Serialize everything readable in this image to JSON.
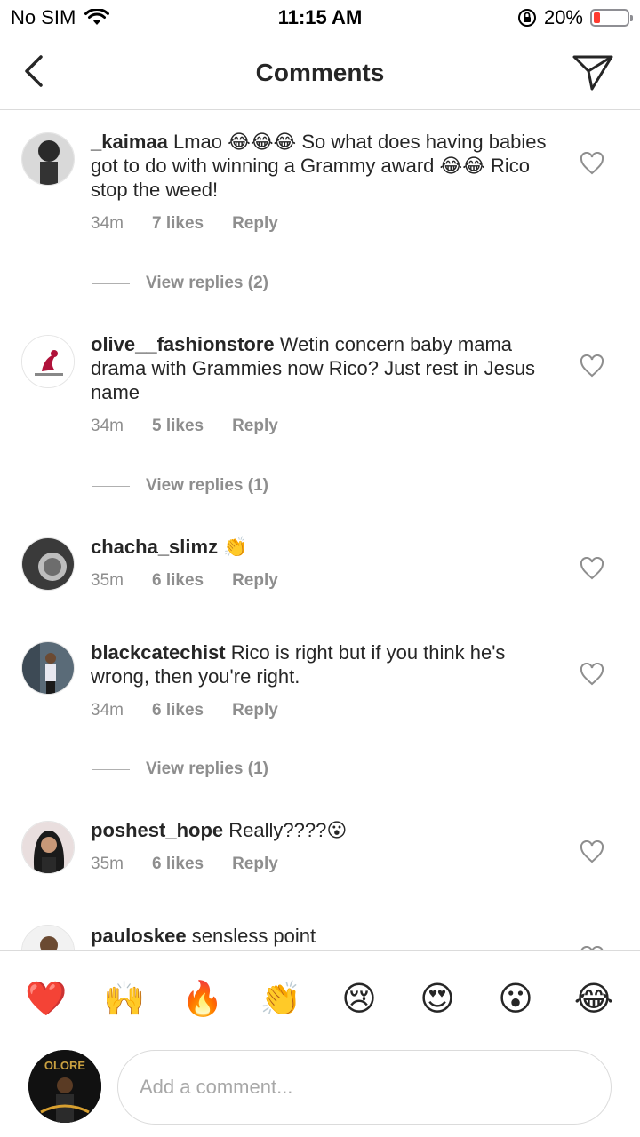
{
  "status_bar": {
    "carrier": "No SIM",
    "time": "11:15 AM",
    "battery": "20%",
    "battery_level": 0.2,
    "icons": [
      "wifi-icon",
      "orientation-lock-icon",
      "battery-icon"
    ]
  },
  "nav": {
    "title": "Comments",
    "back_icon": "chevron-left-icon",
    "send_icon": "paper-plane-icon"
  },
  "comments": [
    {
      "username": "_kaimaa",
      "text": " Lmao 😂😂😂 So what does having babies got to do with winning a Grammy award 😂😂 Rico stop the weed!",
      "time": "34m",
      "likes": "7 likes",
      "reply": "Reply",
      "view_replies": "View replies (2)"
    },
    {
      "username": "olive__fashionstore",
      "text": " Wetin concern baby mama drama with Grammies now Rico? Just rest in Jesus name",
      "time": "34m",
      "likes": "5 likes",
      "reply": "Reply",
      "view_replies": "View replies (1)"
    },
    {
      "username": "chacha_slimz",
      "text": " 👏",
      "time": "35m",
      "likes": "6 likes",
      "reply": "Reply"
    },
    {
      "username": "blackcatechist",
      "text": " Rico is right but if you think he's wrong, then you're right.",
      "time": "34m",
      "likes": "6 likes",
      "reply": "Reply",
      "view_replies": "View replies (1)"
    },
    {
      "username": "poshest_hope",
      "text": " Really????😮",
      "time": "35m",
      "likes": "6 likes",
      "reply": "Reply"
    },
    {
      "username": "pauloskee",
      "text": " sensless point"
    }
  ],
  "emoji_bar": [
    "❤️",
    "🙌",
    "🔥",
    "👏",
    "😢",
    "😍",
    "😮",
    "😂"
  ],
  "composer": {
    "placeholder": "Add a comment...",
    "avatar_text": "OLORE"
  },
  "colors": {
    "text": "#262626",
    "meta": "#8e8e8e",
    "divider": "#dbdbdb",
    "battery_low": "#ff3b30"
  }
}
